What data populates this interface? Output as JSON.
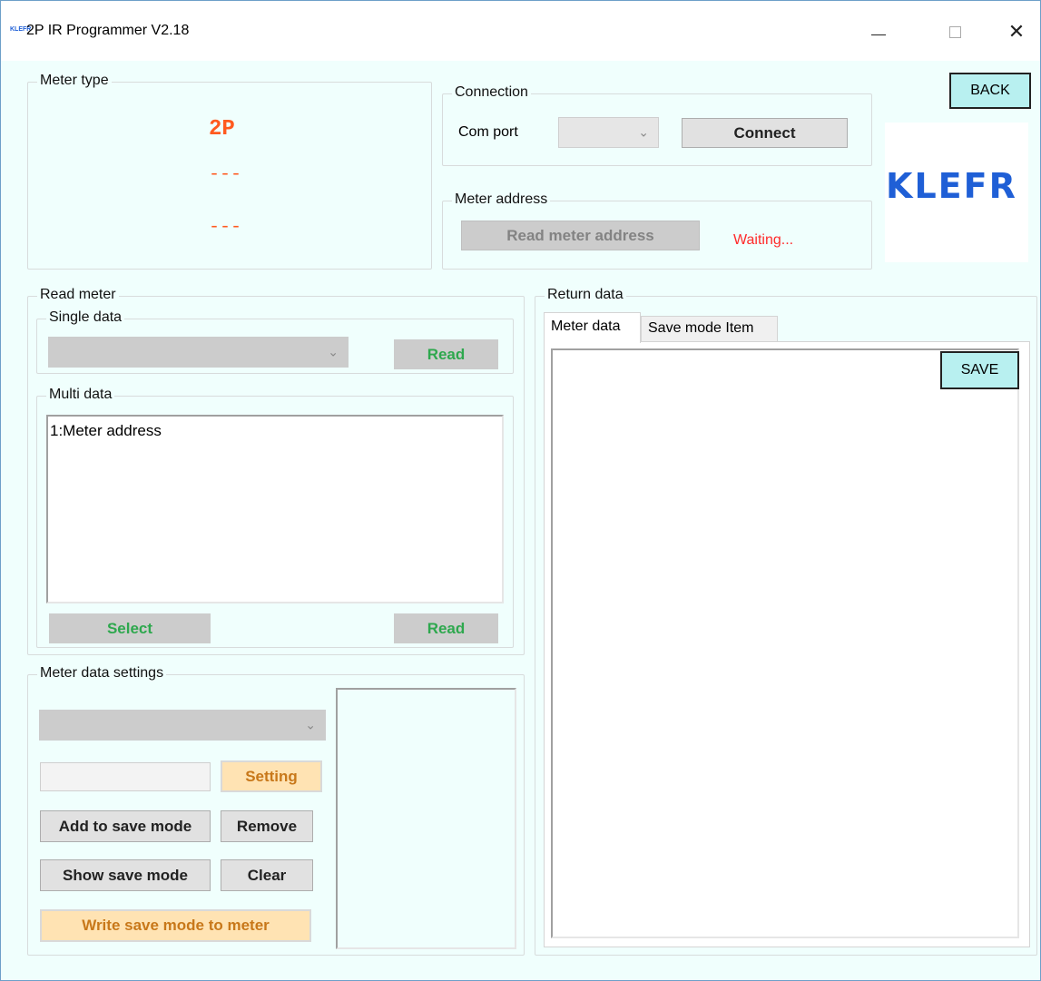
{
  "titlebar": {
    "app_icon_text": "KLEFR",
    "title": "2P IR Programmer V2.18",
    "min_icon": "minimize-icon",
    "max_icon": "maximize-icon",
    "close_icon": "close-icon",
    "close_glyph": "✕"
  },
  "meter_type": {
    "label": "Meter type",
    "values": [
      "2P",
      "---",
      "---"
    ]
  },
  "connection": {
    "label": "Connection",
    "com_port_label": "Com port",
    "com_port_value": "",
    "dropdown_chevron": "⌄",
    "connect_label": "Connect"
  },
  "meter_address": {
    "label": "Meter address",
    "read_button": "Read meter address",
    "status": "Waiting..."
  },
  "back_button": "BACK",
  "logo_text": "KLEFR",
  "read_meter": {
    "label": "Read meter",
    "single_data": {
      "label": "Single data",
      "select_value": "",
      "read_button": "Read"
    },
    "multi_data": {
      "label": "Multi data",
      "items": [
        "1:Meter address"
      ],
      "select_button": "Select",
      "read_button": "Read"
    }
  },
  "meter_data_settings": {
    "label": "Meter data settings",
    "select_value": "",
    "input_value": "",
    "setting_button": "Setting",
    "add_button": "Add to save mode",
    "remove_button": "Remove",
    "show_button": "Show save mode",
    "clear_button": "Clear",
    "write_button": "Write save mode to meter"
  },
  "return_data": {
    "label": "Return data",
    "tabs": [
      {
        "label": "Meter data",
        "active": true
      },
      {
        "label": "Save mode Item",
        "active": false
      }
    ],
    "save_button": "SAVE"
  },
  "colors": {
    "background": "#f0fffd",
    "accent_red": "#ff5a1f",
    "status_red": "#ff2a2a",
    "green_text": "#2ea84e",
    "orange_text": "#c8781a",
    "logo_blue": "#1f5fd6"
  }
}
